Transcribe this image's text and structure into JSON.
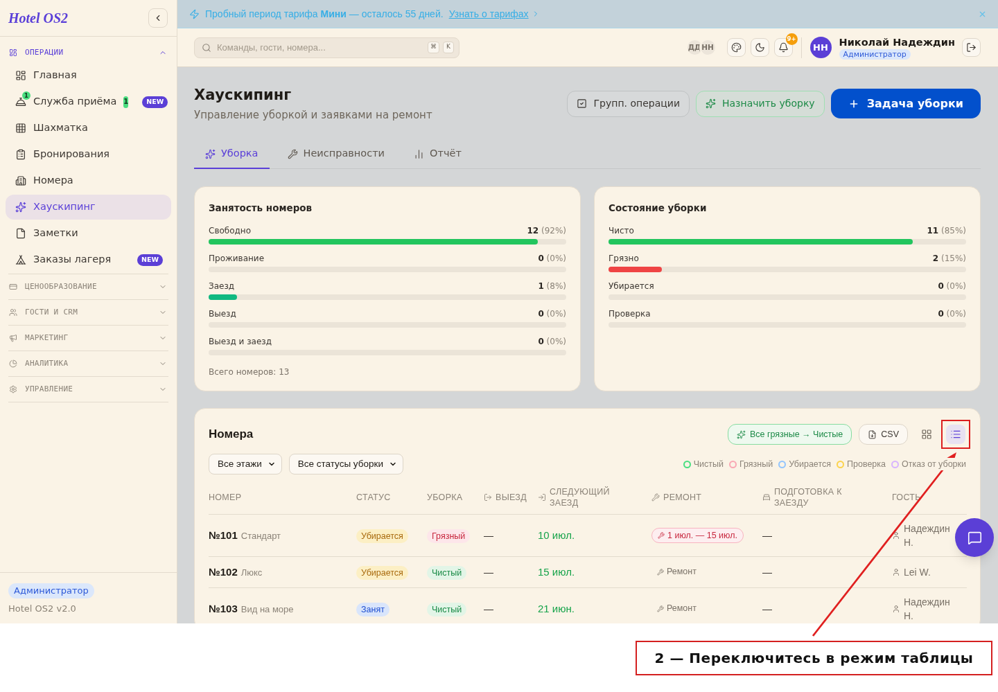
{
  "sidebar": {
    "logo": "Hotel OS2",
    "sections": [
      {
        "label": "ОПЕРАЦИИ",
        "expanded": true,
        "items": [
          {
            "label": "Главная",
            "selected": false
          },
          {
            "label": "Служба приёма",
            "selected": false,
            "icon_badge": "1",
            "count": "1",
            "tag": "NEW"
          },
          {
            "label": "Шахматка",
            "selected": false
          },
          {
            "label": "Бронирования",
            "selected": false
          },
          {
            "label": "Номера",
            "selected": false
          },
          {
            "label": "Хаускипинг",
            "selected": true
          },
          {
            "label": "Заметки",
            "selected": false
          },
          {
            "label": "Заказы лагеря",
            "selected": false,
            "tag": "NEW"
          }
        ]
      },
      {
        "label": "ЦЕНООБРАЗОВАНИЕ",
        "expanded": false
      },
      {
        "label": "ГОСТИ И CRM",
        "expanded": false
      },
      {
        "label": "МАРКЕТИНГ",
        "expanded": false
      },
      {
        "label": "АНАЛИТИКА",
        "expanded": false
      },
      {
        "label": "УПРАВЛЕНИЕ",
        "expanded": false
      }
    ],
    "footer": {
      "role": "Администратор",
      "version": "Hotel OS2 v2.0"
    }
  },
  "banner": {
    "text": "Пробный период тарифа **Мини** — осталось 55 дней.",
    "link": "Узнать о тарифах"
  },
  "header": {
    "search": {
      "placeholder": "Команды, гости, номера...",
      "keys": [
        "⌘",
        "K"
      ]
    },
    "presence": [
      {
        "initials": "ДД"
      },
      {
        "initials": "НН"
      }
    ],
    "notifications": "9+",
    "user": {
      "initials": "НН",
      "name": "Николай Надеждин",
      "role": "Администратор"
    }
  },
  "page": {
    "title": "Хаускипинг",
    "subtitle": "Управление уборкой и заявками на ремонт",
    "actions": [
      {
        "label": "Групп. операции",
        "kind": "outline"
      },
      {
        "label": "Назначить уборку",
        "kind": "success"
      },
      {
        "label": "Задача уборки",
        "kind": "primary"
      }
    ]
  },
  "tabs": [
    {
      "label": "Уборка",
      "selected": true
    },
    {
      "label": "Неисправности",
      "selected": false
    },
    {
      "label": "Отчёт",
      "selected": false
    }
  ],
  "stats": [
    {
      "title": "Занятость номеров",
      "rows": [
        {
          "label": "Свободно",
          "count": "12",
          "percent": "(92%)",
          "level": 0.92,
          "color": "#22c55e"
        },
        {
          "label": "Проживание",
          "count": "0",
          "percent": "(0%)"
        },
        {
          "label": "Заезд",
          "count": "1",
          "percent": "(8%)",
          "level": 0.08,
          "color": "#10b981"
        },
        {
          "label": "Выезд",
          "count": "0",
          "percent": "(0%)"
        },
        {
          "label": "Выезд и заезд",
          "count": "0",
          "percent": "(0%)"
        }
      ],
      "total": "Всего номеров: 13"
    },
    {
      "title": "Состояние уборки",
      "rows": [
        {
          "label": "Чисто",
          "count": "11",
          "percent": "(85%)",
          "level": 0.85,
          "color": "#22c55e"
        },
        {
          "label": "Грязно",
          "count": "2",
          "percent": "(15%)",
          "level": 0.15,
          "color": "#ef4444"
        },
        {
          "label": "Убирается",
          "count": "0",
          "percent": "(0%)"
        },
        {
          "label": "Проверка",
          "count": "0",
          "percent": "(0%)"
        }
      ]
    }
  ],
  "rooms": {
    "title": "Номера",
    "bulk_action": "Все грязные → Чистые",
    "export": "CSV",
    "views": [
      {
        "kind": "grid",
        "selected": false,
        "highlighted": false
      },
      {
        "kind": "list",
        "selected": true,
        "highlighted": true
      }
    ],
    "filters": [
      {
        "value": "Все этажи"
      },
      {
        "value": "Все статусы уборки"
      }
    ],
    "legend": [
      {
        "label": "Чистый",
        "color": "#4ade80"
      },
      {
        "label": "Грязный",
        "color": "#f9a8b4"
      },
      {
        "label": "Убирается",
        "color": "#93c5fd"
      },
      {
        "label": "Проверка",
        "color": "#fcd34d"
      },
      {
        "label": "Отказ от уборки",
        "color": "#d8b4fe"
      }
    ],
    "table": {
      "columns": [
        {
          "label": "НОМЕР"
        },
        {
          "label": "СТАТУС"
        },
        {
          "label": "УБОРКА"
        },
        {
          "label": "ВЫЕЗД"
        },
        {
          "label": "СЛЕДУЮЩИЙ ЗАЕЗД"
        },
        {
          "label": "РЕМОНТ"
        },
        {
          "label": "ПОДГОТОВКА К ЗАЕЗДУ"
        },
        {
          "label": "ГОСТЬ"
        }
      ],
      "rows": [
        {
          "number": "№101",
          "type": "Стандарт",
          "status": {
            "label": "Убирается",
            "kind": "cleaning"
          },
          "cleaning": {
            "label": "Грязный",
            "kind": "dirty"
          },
          "checkout": "—",
          "next_arrival": "10 июл.",
          "repair": {
            "label": "1 июл. — 15 июл.",
            "kind": "period"
          },
          "preparation": "—",
          "guest": "Надеждин Н."
        },
        {
          "number": "№102",
          "type": "Люкс",
          "status": {
            "label": "Убирается",
            "kind": "cleaning"
          },
          "cleaning": {
            "label": "Чистый",
            "kind": "clean"
          },
          "checkout": "—",
          "next_arrival": "15 июл.",
          "repair": {
            "label": "Ремонт",
            "kind": "action"
          },
          "preparation": "—",
          "guest": "Lei W."
        },
        {
          "number": "№103",
          "type": "Вид на море",
          "status": {
            "label": "Занят",
            "kind": "occupied"
          },
          "cleaning": {
            "label": "Чистый",
            "kind": "clean"
          },
          "checkout": "—",
          "next_arrival": "21 июн.",
          "repair": {
            "label": "Ремонт",
            "kind": "action"
          },
          "preparation": "—",
          "guest": "Надеждин Н."
        }
      ]
    }
  },
  "annotation": {
    "text": "2 — Переключитесь в режим таблицы"
  }
}
